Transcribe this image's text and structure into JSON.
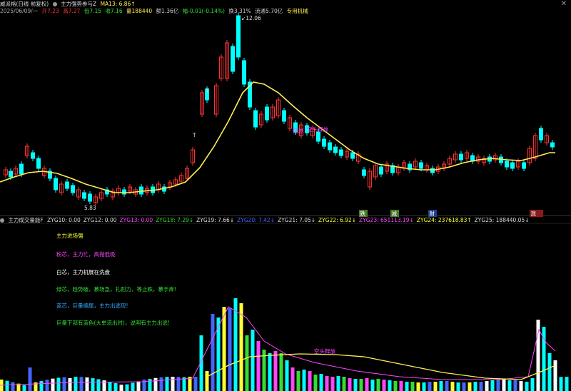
{
  "window": {
    "title": "威派格(日线 前复权)",
    "indicator_name": "主力强势参与Z",
    "ma_label": "MA13: 6.86↑",
    "close_label": "✕"
  },
  "quote": {
    "date": "2025/06/09/一",
    "open": "开7.23",
    "high": "高7.27",
    "low": "低7.15",
    "close": "收7.16",
    "volume": "量188440",
    "amount": "额1.36亿",
    "change": "幅-0.01(-0.14%)",
    "turnover": "换3.31%",
    "float": "流通5.70亿",
    "tag": "专用机械"
  },
  "price_chart": {
    "high_label": "12.06",
    "low_label": "5.83",
    "annotations": [
      "空头释放",
      "低进"
    ],
    "t_markers": [
      "T",
      "T"
    ],
    "signals": [
      {
        "label": "跌",
        "bg": "#4a7a2a",
        "color": "#fff"
      },
      {
        "label": "减",
        "bg": "#4a7a2a",
        "color": "#fff"
      },
      {
        "label": "财",
        "bg": "#1e3f8f",
        "color": "#fff"
      },
      {
        "label": "涨",
        "bg": "#8a1a1a",
        "color": "#fff"
      }
    ]
  },
  "volume_panel": {
    "title": "主力成交量能F",
    "values": [
      {
        "name": "ZYG10: 0.00",
        "color": "#dddddd"
      },
      {
        "name": "ZYG12: 0.00",
        "color": "#dddddd"
      },
      {
        "name": "ZYG13: 0.00",
        "color": "#ff44ff"
      },
      {
        "name": "ZYG18: 7.29↓",
        "color": "#33dd33"
      },
      {
        "name": "ZYG19: 7.66↓",
        "color": "#dddddd"
      },
      {
        "name": "ZYG20: 7.42↓",
        "color": "#4466ff"
      },
      {
        "name": "ZYG21: 7.05↓",
        "color": "#dddddd"
      },
      {
        "name": "ZYG22: 6.92↓",
        "color": "#ffff33"
      },
      {
        "name": "ZYG23: 651113.19↓",
        "color": "#ff44ff"
      },
      {
        "name": "ZYG24: 237618.83↑",
        "color": "#ffff33"
      },
      {
        "name": "ZYG25: 188440.05↓",
        "color": "#dddddd"
      }
    ],
    "legend": [
      {
        "text": "主力进场强",
        "color": "#ffff33"
      },
      {
        "text": "粉芯，主力忙，高抛低吸",
        "color": "#ff44ff"
      },
      {
        "text": "白芯，主力机展在洗盘",
        "color": "#ffffff"
      },
      {
        "text": "绿芯，趋势破，慕场急，扎耐力，等止跌，慕手痒!",
        "color": "#33dd33"
      },
      {
        "text": "蓝芯，巨量缩尾，主力出逃现!",
        "color": "#33aaff"
      },
      {
        "text": "巨量下部有蓝色(大单流出时)，说明有主力出逃!",
        "color": "#33dd33"
      }
    ],
    "annotation": "空头释放"
  },
  "colors": {
    "up": "#ff3333",
    "down": "#00ffff",
    "ma": "#ffff44"
  }
}
